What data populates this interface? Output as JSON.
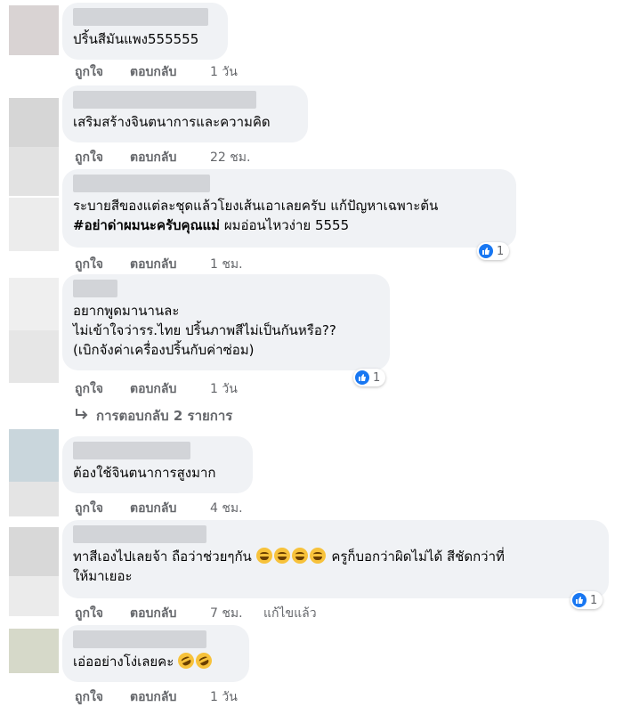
{
  "actions": {
    "like": "ถูกใจ",
    "reply": "ตอบกลับ",
    "edited": "แก้ไขแล้ว"
  },
  "view_replies": "การตอบกลับ 2 รายการ",
  "comments": [
    {
      "text": "ปริ้นสีมันแพง555555",
      "time": "1 วัน"
    },
    {
      "text": "เสริมสร้างจินตนาการและความคิด",
      "time": "22 ชม."
    },
    {
      "text_plain": "ระบายสีของแต่ละชุดแล้วโยงเส้นเอาเลยครับ แก้ปัญหาเฉพาะต้น",
      "hashtag": "#อย่าด่าผมนะครับคุณแม่",
      "text_after": " ผมอ่อนไหวง่าย 5555",
      "time": "1 ชม.",
      "reactions": "1"
    },
    {
      "line1": "อยากพูดมานานละ",
      "line2": "ไม่เข้าใจว่ารร.ไทย ปริ้นภาพสีไม่เป็นกันหรือ??",
      "line3": "(เบิกจังค่าเครื่องปริ้นกับค่าซ่อม)",
      "time": "1 วัน",
      "reactions": "1"
    },
    {
      "text": "ต้องใช้จินตนาการสูงมาก",
      "time": "4 ชม."
    },
    {
      "text_before": "ทาสีเองไปเลยจ้า ถือว่าช่วยๆกัน ",
      "text_after": " ครูก็บอกว่าผิดไม่ได้ สีชัดกว่าที่",
      "line2": "ให้มาเยอะ",
      "time": "7 ชม.",
      "reactions": "1"
    },
    {
      "text": "เอ่ออย่างโง่เลยคะ ",
      "time": "1 วัน"
    }
  ],
  "colors": {
    "accent": "#1877f2",
    "bubble": "#f0f2f5",
    "meta": "#65676b"
  }
}
